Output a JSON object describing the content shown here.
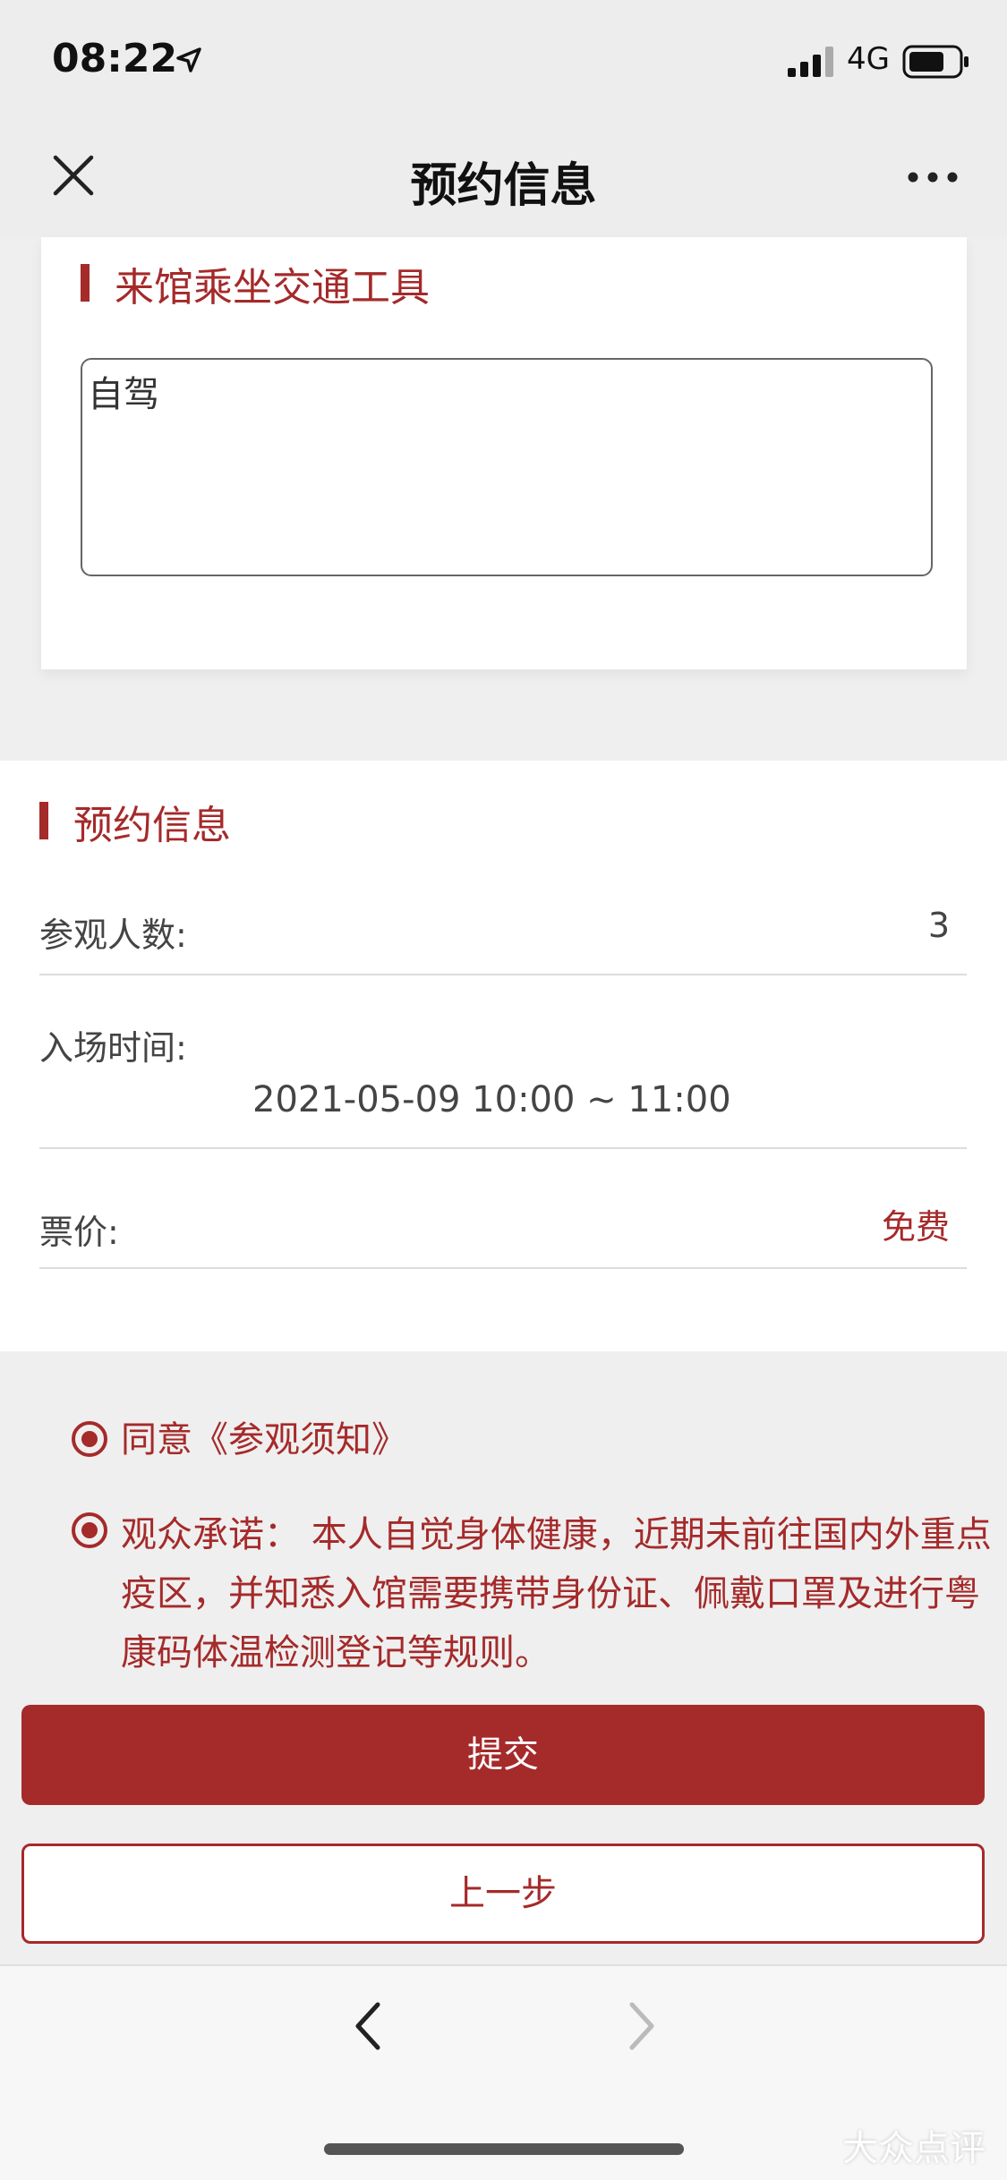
{
  "status_bar": {
    "time": "08:22",
    "network": "4G",
    "icons": [
      "location-arrow-icon",
      "signal-icon",
      "battery-icon"
    ]
  },
  "nav": {
    "title": "预约信息",
    "left_icon": "close-icon",
    "right_icon": "more-icon"
  },
  "transport": {
    "section_title": "来馆乘坐交通工具",
    "value": "自驾"
  },
  "reservation": {
    "section_title": "预约信息",
    "visitors_label": "参观人数:",
    "visitors_value": "3",
    "entry_time_label": "入场时间:",
    "entry_time_value": "2021-05-09 10:00 ~ 11:00",
    "price_label": "票价:",
    "price_value": "免费"
  },
  "agreements": {
    "notice": "同意《参观须知》",
    "promise": "观众承诺： 本人自觉身体健康，近期未前往国内外重点疫区，并知悉入馆需要携带身份证、佩戴口罩及进行粤康码体温检测登记等规则。"
  },
  "buttons": {
    "submit": "提交",
    "previous": "上一步"
  },
  "toolbar": {
    "back_icon": "chevron-left-icon",
    "forward_icon": "chevron-right-icon"
  },
  "watermark": "大众点评",
  "colors": {
    "accent": "#a52a2a",
    "background": "#efefef",
    "card": "#ffffff"
  }
}
